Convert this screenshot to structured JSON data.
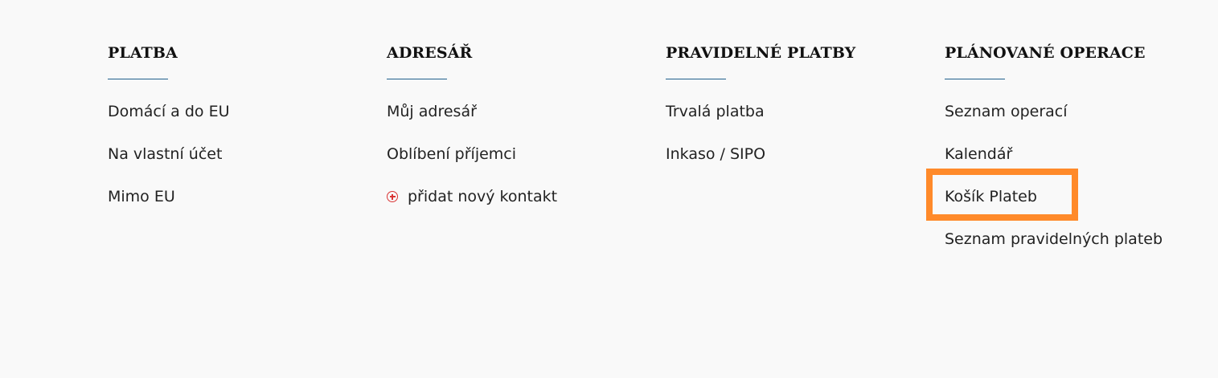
{
  "columns": [
    {
      "title": "PLATBA",
      "items": [
        {
          "label": "Domácí a do EU"
        },
        {
          "label": "Na vlastní účet"
        },
        {
          "label": "Mimo EU"
        }
      ]
    },
    {
      "title": "ADRESÁŘ",
      "items": [
        {
          "label": "Můj adresář"
        },
        {
          "label": "Oblíbení příjemci"
        },
        {
          "label": "přidat nový kontakt",
          "icon": "add-circle-icon"
        }
      ]
    },
    {
      "title": "PRAVIDELNÉ PLATBY",
      "items": [
        {
          "label": "Trvalá platba"
        },
        {
          "label": "Inkaso / SIPO"
        }
      ]
    },
    {
      "title": "PLÁNOVANÉ OPERACE",
      "items": [
        {
          "label": "Seznam operací"
        },
        {
          "label": "Kalendář"
        },
        {
          "label": "Košík Plateb"
        },
        {
          "label": "Seznam pravidelných plateb"
        }
      ]
    }
  ],
  "colors": {
    "background": "#f9f9f9",
    "underline": "#1f5f8b",
    "add_icon": "#d93434",
    "highlight": "#ff8a2a"
  }
}
